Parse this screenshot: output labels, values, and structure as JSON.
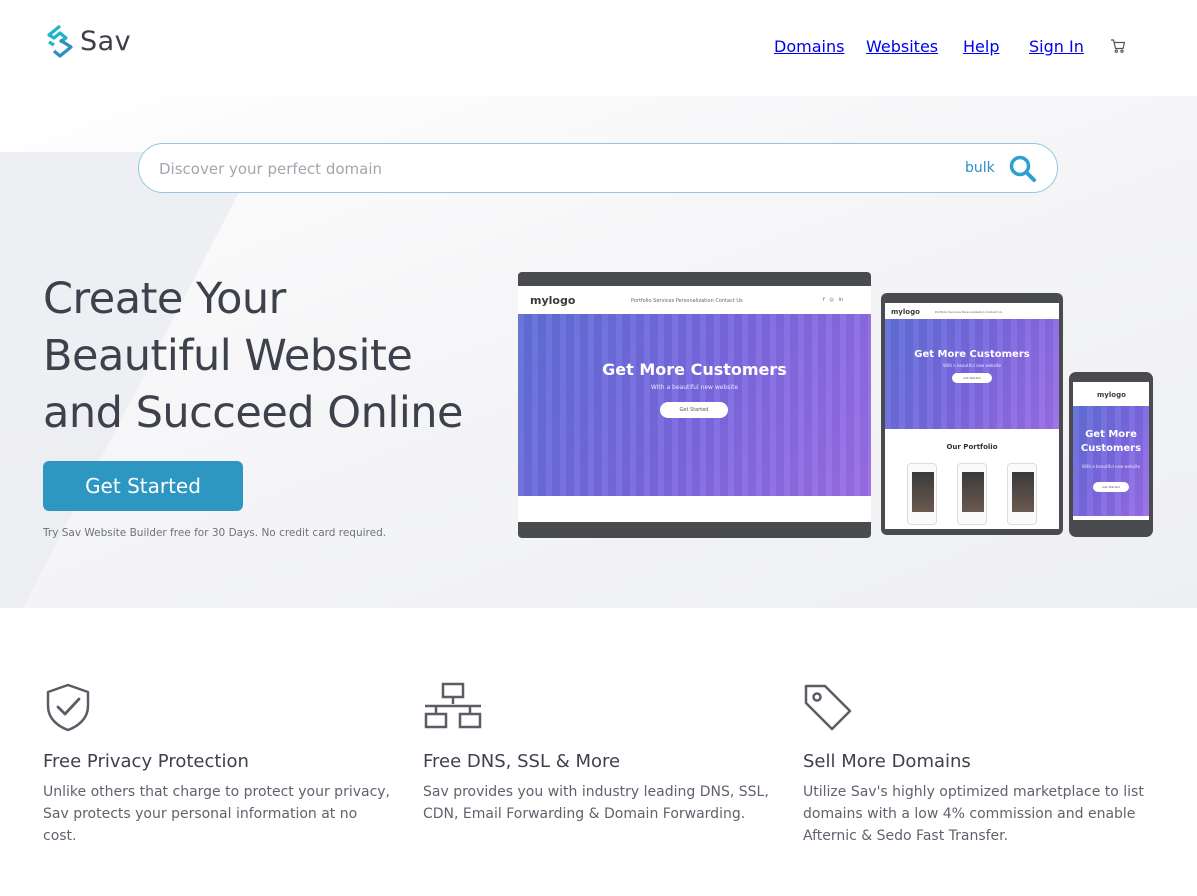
{
  "brand": {
    "name": "Sav",
    "accent": "#2d97c1",
    "logo_colors": [
      "#1fb5c9",
      "#2d8fc3"
    ]
  },
  "nav": {
    "items": [
      {
        "label": "Domains"
      },
      {
        "label": "Websites"
      },
      {
        "label": "Help"
      },
      {
        "label": "Sign In"
      }
    ],
    "cart_icon": "shopping-cart-icon"
  },
  "search": {
    "placeholder": "Discover your perfect domain",
    "value": "",
    "bulk_label": "bulk",
    "icon": "search-icon"
  },
  "hero": {
    "headline_lines": [
      "Create Your",
      "Beautiful Website",
      "and Succeed Online"
    ],
    "cta_label": "Get Started",
    "cta_note": "Try Sav Website Builder free for 30 Days. No credit card required."
  },
  "mockups": {
    "logo": "mylogo",
    "nav_links": "Portfolio   Services   Personalization   Contact Us",
    "hero_title": "Get More Customers",
    "hero_subtitle": "With a beautiful new website",
    "hero_button": "Get Started",
    "portfolio_title": "Our Portfolio"
  },
  "features": [
    {
      "icon": "shield-check-icon",
      "title": "Free Privacy Protection",
      "text": "Unlike others that charge to protect your privacy, Sav protects your personal information at no cost."
    },
    {
      "icon": "network-icon",
      "title": "Free DNS, SSL & More",
      "text": "Sav provides you with industry leading DNS, SSL, CDN, Email Forwarding & Domain Forwarding."
    },
    {
      "icon": "tag-icon",
      "title": "Sell More Domains",
      "text": "Utilize Sav's highly optimized marketplace to list domains with a low 4% commission and enable Afternic & Sedo Fast Transfer."
    }
  ]
}
